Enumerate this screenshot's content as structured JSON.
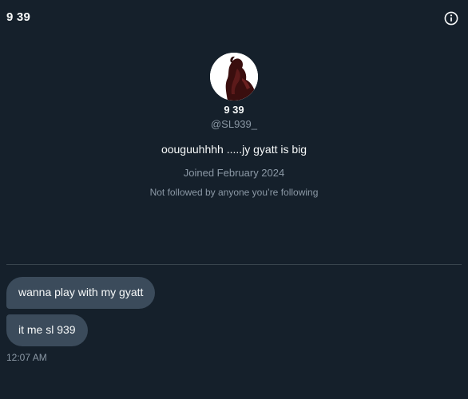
{
  "header": {
    "title": "9 39",
    "info_icon": "info-circle-icon"
  },
  "profile": {
    "avatar": "avatar-image",
    "display_name": "9 39",
    "handle": "@SL939_",
    "bio": "oouguuhhhh .....jy gyatt is big",
    "joined": "Joined February 2024",
    "followers_note": "Not followed by anyone you’re following"
  },
  "messages": [
    {
      "text": "wanna play with my gyatt"
    },
    {
      "text": "it me sl 939"
    }
  ],
  "timestamp": "12:07 AM",
  "colors": {
    "background": "#15202b",
    "bubble": "#3b4b5b",
    "secondary_text": "#8b98a5",
    "divider": "#38444d"
  }
}
